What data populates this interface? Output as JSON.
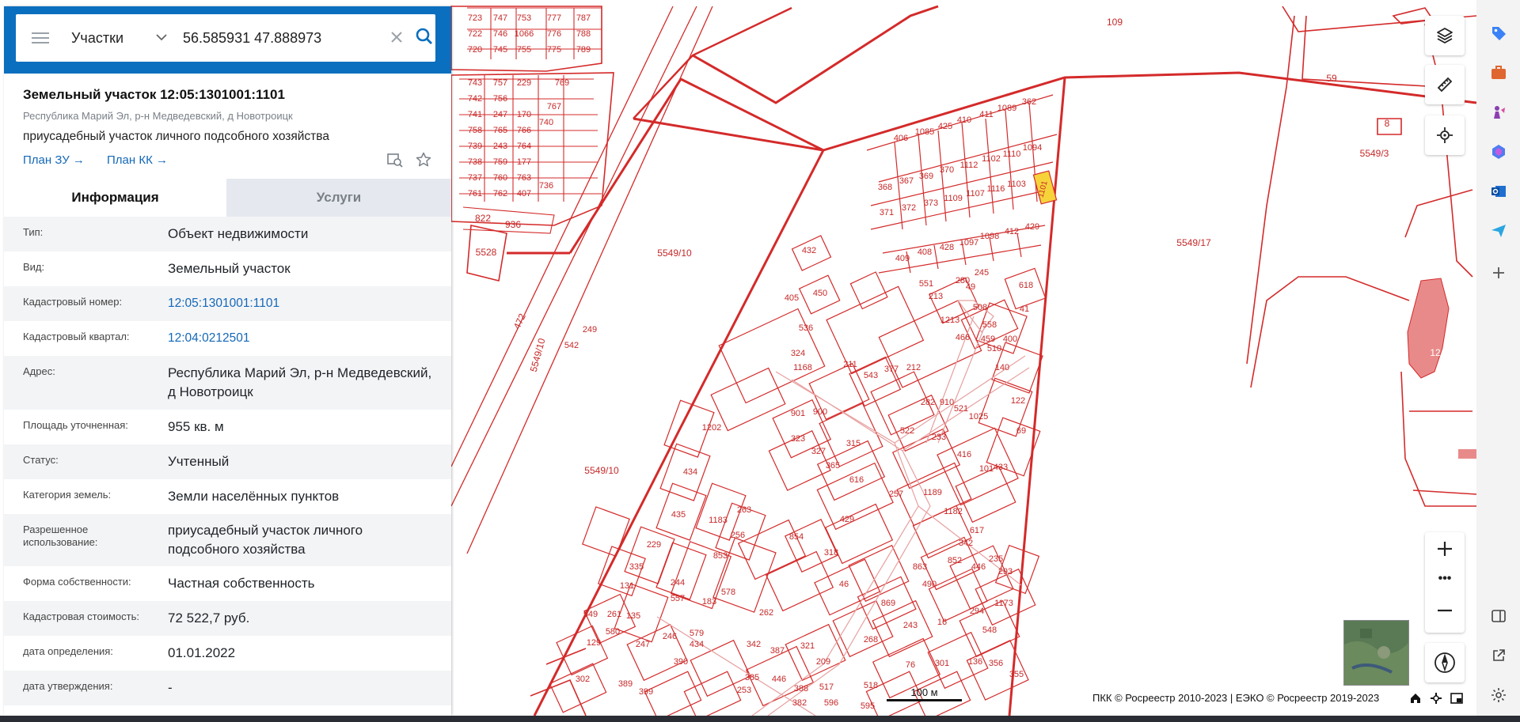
{
  "search": {
    "layer": "Участки",
    "query": "56.585931 47.888973"
  },
  "card": {
    "title": "Земельный участок 12:05:1301001:1101",
    "address_line": "Республика Марий Эл, р-н Медведевский, д Новотроицк",
    "purpose": "приусадебный участок личного подсобного хозяйства",
    "plan_zu": "План ЗУ",
    "plan_kk": "План КК"
  },
  "tabs": {
    "info": "Информация",
    "services": "Услуги"
  },
  "rows": [
    {
      "label": "Тип:",
      "value": "Объект недвижимости"
    },
    {
      "label": "Вид:",
      "value": "Земельный участок"
    },
    {
      "label": "Кадастровый номер:",
      "value": "12:05:1301001:1101"
    },
    {
      "label": "Кадастровый квартал:",
      "value": "12:04:0212501"
    },
    {
      "label": "Адрес:",
      "value": "Республика Марий Эл, р-н Медведевский, д Новотроицк"
    },
    {
      "label": "Площадь уточненная:",
      "value": "955 кв. м"
    },
    {
      "label": "Статус:",
      "value": "Учтенный"
    },
    {
      "label": "Категория земель:",
      "value": "Земли населённых пунктов"
    },
    {
      "label": "Разрешенное использование:",
      "value": "приусадебный участок личного подсобного хозяйства"
    },
    {
      "label": "Форма собственности:",
      "value": "Частная собственность"
    },
    {
      "label": "Кадастровая стоимость:",
      "value": "72 522,7 руб."
    },
    {
      "label": "дата определения:",
      "value": "01.01.2022"
    },
    {
      "label": "дата утверждения:",
      "value": "-"
    }
  ],
  "map": {
    "attribution": "ПКК © Росреестр 2010-2023 | ЕЭКО © Росреестр 2019-2023",
    "scale_label": "100 м",
    "labels": {
      "l5549_10a": "5549/10",
      "l5549_10b": "5549/10",
      "l5549_10c": "5549/10",
      "l5549_17": "5549/17",
      "l5549_3": "5549/3",
      "l5528": "5528",
      "l472": "472",
      "l109": "109",
      "l59": "59",
      "l8": "8",
      "l12": "12",
      "l1101": "1101",
      "l822": "822",
      "l936": "936"
    },
    "parcel_numbers": [
      "723",
      "747",
      "753",
      "777",
      "787",
      "722",
      "746",
      "1066",
      "776",
      "788",
      "720",
      "745",
      "755",
      "775",
      "789",
      "743",
      "757",
      "229",
      "769",
      "742",
      "756",
      "767",
      "741",
      "247",
      "170",
      "740",
      "758",
      "765",
      "766",
      "739",
      "243",
      "764",
      "738",
      "759",
      "177",
      "737",
      "760",
      "763",
      "736",
      "761",
      "762",
      "407",
      "406",
      "1085",
      "425",
      "410",
      "411",
      "1089",
      "362",
      "368",
      "367",
      "369",
      "370",
      "1112",
      "1102",
      "1110",
      "1094",
      "371",
      "372",
      "373",
      "1109",
      "1107",
      "1116",
      "1103",
      "409",
      "408",
      "428",
      "1097",
      "1098",
      "412",
      "429",
      "280",
      "245",
      "618",
      "41",
      "49",
      "551",
      "1213",
      "508",
      "558",
      "510",
      "400",
      "405",
      "450",
      "536",
      "324",
      "1168",
      "211",
      "543",
      "377",
      "212",
      "901",
      "900",
      "282",
      "910",
      "521",
      "1025",
      "323",
      "327",
      "315",
      "522",
      "233",
      "416",
      "365",
      "616",
      "257",
      "101",
      "433",
      "429",
      "1189",
      "1182",
      "617",
      "1202",
      "434",
      "435",
      "1183",
      "263",
      "256",
      "853",
      "854",
      "318",
      "46",
      "863",
      "490",
      "342",
      "852",
      "446",
      "235",
      "293",
      "229",
      "335",
      "131",
      "244",
      "557",
      "183",
      "578",
      "579",
      "261",
      "262",
      "869",
      "243",
      "16",
      "294",
      "1173",
      "548",
      "549",
      "580",
      "135",
      "129",
      "247",
      "246",
      "434",
      "342",
      "387",
      "321",
      "209",
      "268",
      "76",
      "301",
      "136",
      "356",
      "355",
      "302",
      "389",
      "390",
      "385",
      "446",
      "399",
      "253",
      "388",
      "517",
      "518",
      "382",
      "596",
      "595",
      "542",
      "249",
      "213",
      "466",
      "459",
      "140",
      "122",
      "69",
      "432"
    ]
  },
  "colors": {
    "accent": "#0b6fbf",
    "parcel_line": "#d42a2a",
    "highlight": "#f6d33b"
  },
  "icons": [
    "menu-icon",
    "chevron-down-icon",
    "clear-icon",
    "search-icon",
    "collapse-icon",
    "find-on-map-icon",
    "star-icon",
    "layers-icon",
    "ruler-icon",
    "locate-icon",
    "zoom-in-icon",
    "more-icon",
    "zoom-out-icon",
    "compass-icon",
    "home-icon",
    "crosshair-icon",
    "fullscreen-icon"
  ]
}
